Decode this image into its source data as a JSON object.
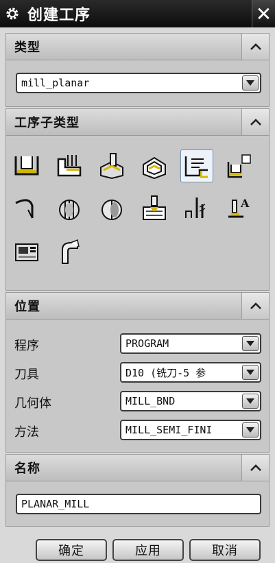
{
  "window": {
    "title": "创建工序",
    "icon": "gear-icon",
    "close_icon": "close-icon"
  },
  "type_section": {
    "title": "类型",
    "select_value": "mill_planar"
  },
  "subtype_section": {
    "title": "工序子类型",
    "icons": [
      "floor-wall-icon",
      "floor-wall-ipw-icon",
      "face-milling-icon",
      "face-milling-area-icon",
      "planar-mill-icon",
      "planar-profile-icon",
      "clean-up-corners-icon",
      "finish-walls-icon",
      "finish-floor-icon",
      "hole-chamfer-icon",
      "thread-milling-icon",
      "planar-text-icon",
      "mill-control-icon",
      "mill-user-icon"
    ],
    "selected_index": 4
  },
  "location_section": {
    "title": "位置",
    "fields": [
      {
        "label": "程序",
        "value": "PROGRAM"
      },
      {
        "label": "刀具",
        "value": "D10 (铣刀-5 参"
      },
      {
        "label": "几何体",
        "value": "MILL_BND"
      },
      {
        "label": "方法",
        "value": "MILL_SEMI_FINI"
      }
    ]
  },
  "name_section": {
    "title": "名称",
    "value": "PLANAR_MILL"
  },
  "buttons": {
    "ok": "确定",
    "apply": "应用",
    "cancel": "取消"
  }
}
